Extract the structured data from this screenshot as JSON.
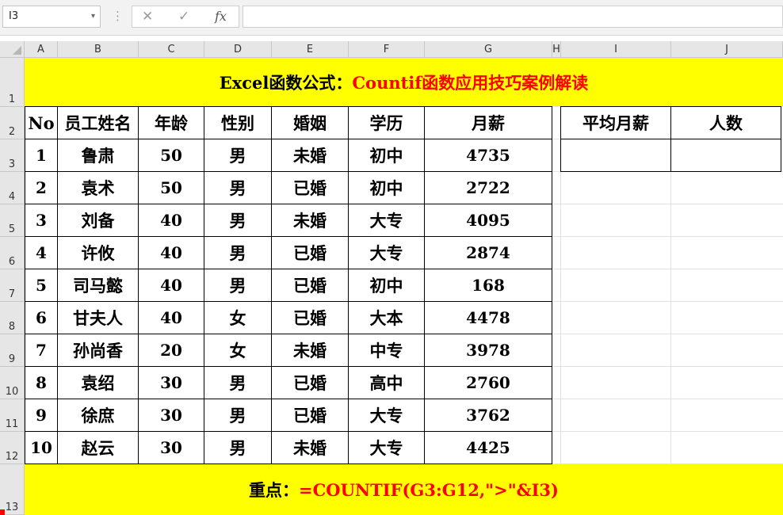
{
  "formula_bar": {
    "name_box": "I3",
    "name_box_caret": "▾",
    "dots": "⋮",
    "cancel_glyph": "✕",
    "enter_glyph": "✓",
    "fx_glyph": "fx",
    "formula_value": ""
  },
  "columns": [
    "A",
    "B",
    "C",
    "D",
    "E",
    "F",
    "G",
    "H",
    "I",
    "J"
  ],
  "rows": [
    "1",
    "2",
    "3",
    "4",
    "5",
    "6",
    "7",
    "8",
    "9",
    "10",
    "11",
    "12",
    "13"
  ],
  "title": {
    "part1": "Excel函数公式：",
    "part2": "Countif函数应用技巧案例解读"
  },
  "table": {
    "headers": [
      "No",
      "员工姓名",
      "年龄",
      "性别",
      "婚姻",
      "学历",
      "月薪"
    ],
    "rows": [
      [
        "1",
        "鲁肃",
        "50",
        "男",
        "未婚",
        "初中",
        "4735"
      ],
      [
        "2",
        "袁术",
        "50",
        "男",
        "已婚",
        "初中",
        "2722"
      ],
      [
        "3",
        "刘备",
        "40",
        "男",
        "未婚",
        "大专",
        "4095"
      ],
      [
        "4",
        "许攸",
        "40",
        "男",
        "已婚",
        "大专",
        "2874"
      ],
      [
        "5",
        "司马懿",
        "40",
        "男",
        "已婚",
        "初中",
        "168"
      ],
      [
        "6",
        "甘夫人",
        "40",
        "女",
        "已婚",
        "大本",
        "4478"
      ],
      [
        "7",
        "孙尚香",
        "20",
        "女",
        "未婚",
        "中专",
        "3978"
      ],
      [
        "8",
        "袁绍",
        "30",
        "男",
        "已婚",
        "高中",
        "2760"
      ],
      [
        "9",
        "徐庶",
        "30",
        "男",
        "已婚",
        "大专",
        "3762"
      ],
      [
        "10",
        "赵云",
        "30",
        "男",
        "未婚",
        "大专",
        "4425"
      ]
    ]
  },
  "side_table": {
    "headers": [
      "平均月薪",
      "人数"
    ],
    "values": [
      "",
      ""
    ]
  },
  "footer": {
    "label": "重点：",
    "formula": "=COUNTIF(G3:G12,\">\"&I3)"
  },
  "colors": {
    "band_bg": "#ffff00",
    "accent_red": "#ff0000",
    "header_bg": "#e6e6e6"
  }
}
